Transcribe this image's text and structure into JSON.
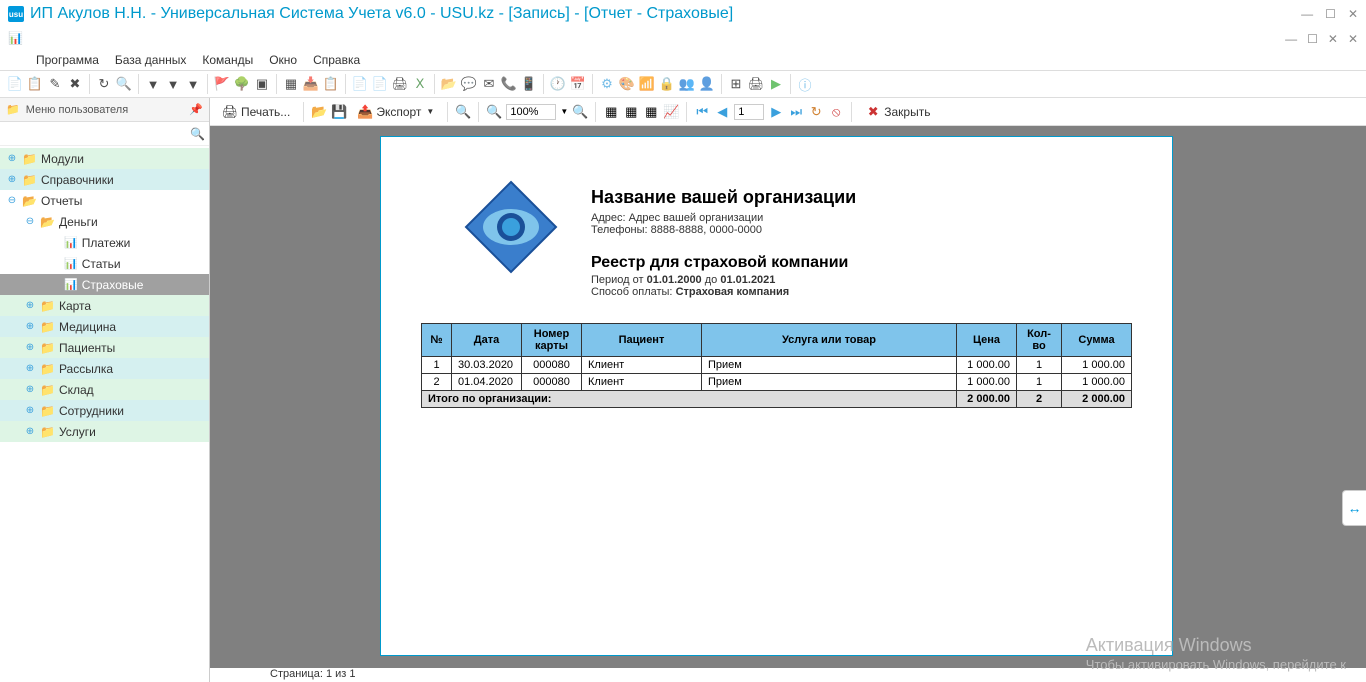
{
  "window": {
    "title": "ИП Акулов Н.Н. - Универсальная Система Учета v6.0 - USU.kz - [Запись] - [Отчет - Страховые]"
  },
  "menu": {
    "program": "Программа",
    "database": "База данных",
    "commands": "Команды",
    "window": "Окно",
    "help": "Справка"
  },
  "sidebar": {
    "title": "Меню пользователя",
    "search_placeholder": "",
    "items": {
      "modules": "Модули",
      "directories": "Справочники",
      "reports": "Отчеты",
      "money": "Деньги",
      "payments": "Платежи",
      "articles": "Статьи",
      "insurance": "Страховые",
      "card": "Карта",
      "medicine": "Медицина",
      "patients": "Пациенты",
      "mailing": "Рассылка",
      "warehouse": "Склад",
      "employees": "Сотрудники",
      "services": "Услуги"
    }
  },
  "report_toolbar": {
    "print": "Печать...",
    "export": "Экспорт",
    "zoom": "100%",
    "page": "1",
    "close": "Закрыть"
  },
  "report": {
    "org_name": "Название вашей организации",
    "address_label": "Адрес:",
    "address": "Адрес вашей организации",
    "phones_label": "Телефоны:",
    "phones": "8888-8888, 0000-0000",
    "title": "Реестр для страховой компании",
    "period_label": "Период от",
    "period_from": "01.01.2000",
    "period_to_label": "до",
    "period_to": "01.01.2021",
    "method_label": "Способ оплаты:",
    "method": "Страховая компания",
    "headers": {
      "no": "№",
      "date": "Дата",
      "card": "Номер карты",
      "patient": "Пациент",
      "service": "Услуга или товар",
      "price": "Цена",
      "qty": "Кол-во",
      "sum": "Сумма"
    },
    "rows": [
      {
        "no": "1",
        "date": "30.03.2020",
        "card": "000080",
        "patient": "Клиент",
        "service": "Прием",
        "price": "1 000.00",
        "qty": "1",
        "sum": "1 000.00"
      },
      {
        "no": "2",
        "date": "01.04.2020",
        "card": "000080",
        "patient": "Клиент",
        "service": "Прием",
        "price": "1 000.00",
        "qty": "1",
        "sum": "1 000.00"
      }
    ],
    "total_label": "Итого по организации:",
    "total_price": "2 000.00",
    "total_qty": "2",
    "total_sum": "2 000.00"
  },
  "status": {
    "page": "Страница: 1 из 1"
  },
  "watermark": {
    "title": "Активация Windows",
    "sub": "Чтобы активировать Windows, перейдите к"
  }
}
